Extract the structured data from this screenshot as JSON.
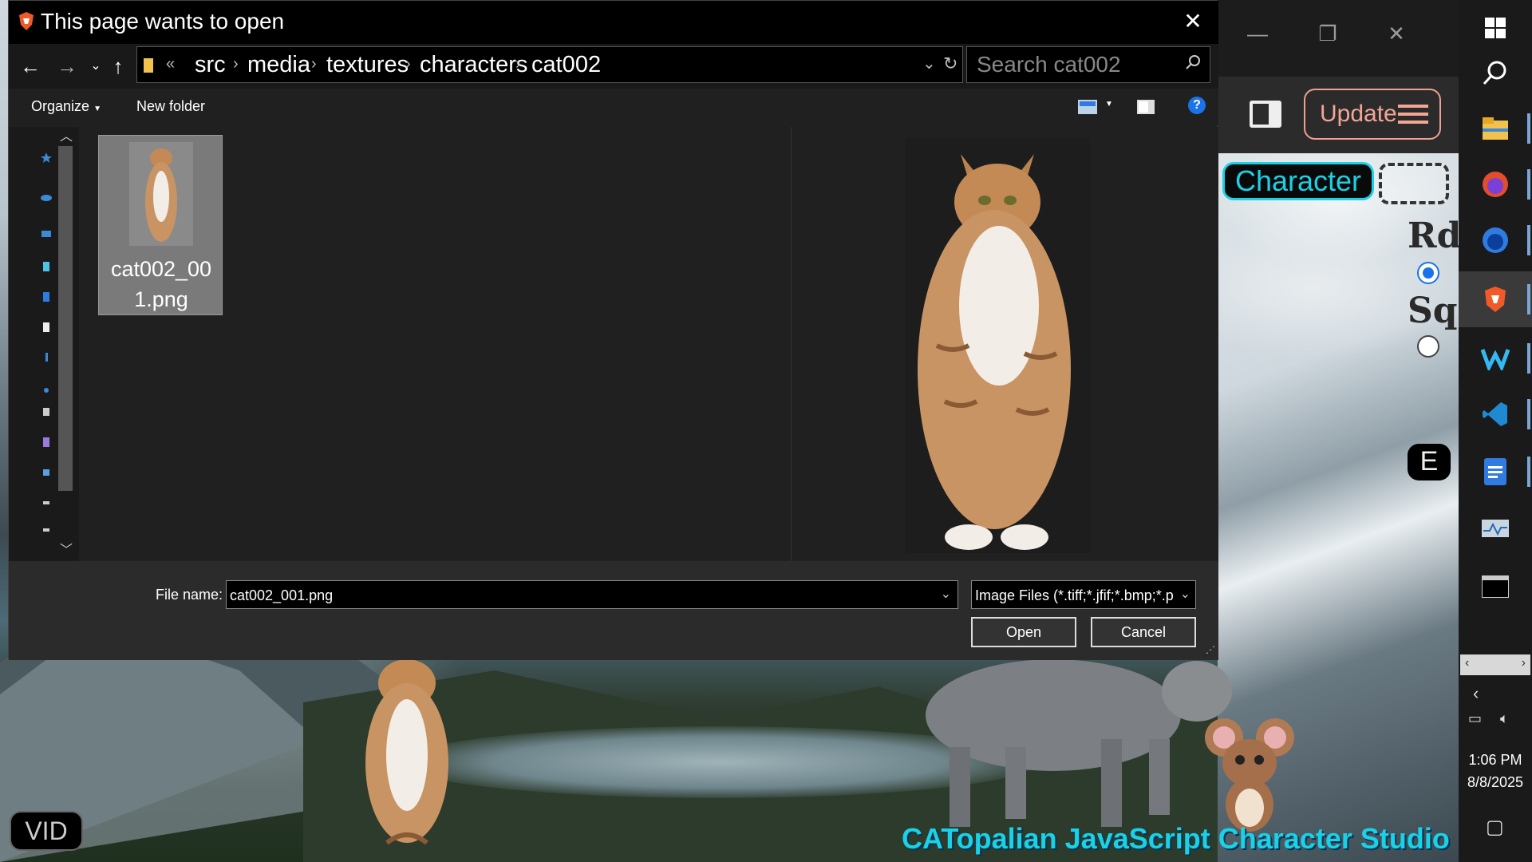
{
  "dialog": {
    "title": "This page wants to open",
    "breadcrumb": [
      "src",
      "media",
      "textures",
      "characters",
      "cat002"
    ],
    "overflow_marker": "«",
    "search_placeholder": "Search cat002",
    "organize_label": "Organize",
    "new_folder_label": "New folder",
    "help_label": "?",
    "file": {
      "name": "cat002_001.png",
      "name_line1": "cat002_00",
      "name_line2": "1.png"
    },
    "file_name_label": "File name:",
    "file_name_value": "cat002_001.png",
    "file_type_value": "Image Files (*.tiff;*.jfif;*.bmp;*.p",
    "open_label": "Open",
    "cancel_label": "Cancel"
  },
  "app": {
    "update_label": "Update",
    "character_label": "Character",
    "shape_rd_label": "Rd",
    "shape_sq_label": "Sq",
    "shape_selected": "Rd",
    "e_label": "E",
    "vid_label": "VID",
    "studio_title": "CATopalian JavaScript Character Studio"
  },
  "taskbar": {
    "icons": [
      "windows-start-icon",
      "search-icon",
      "file-explorer-icon",
      "firefox-icon",
      "firefox-developer-icon",
      "brave-icon",
      "windsurf-icon",
      "vscode-icon",
      "docs-icon",
      "task-manager-icon",
      "terminal-icon"
    ],
    "active_icon": "brave-icon",
    "time": "1:06 PM",
    "date": "8/8/2025"
  },
  "colors": {
    "accent_cyan": "#1ad1e6",
    "update_salmon": "#f4a594",
    "brave_orange": "#f05a28",
    "help_blue": "#1a73e8"
  }
}
